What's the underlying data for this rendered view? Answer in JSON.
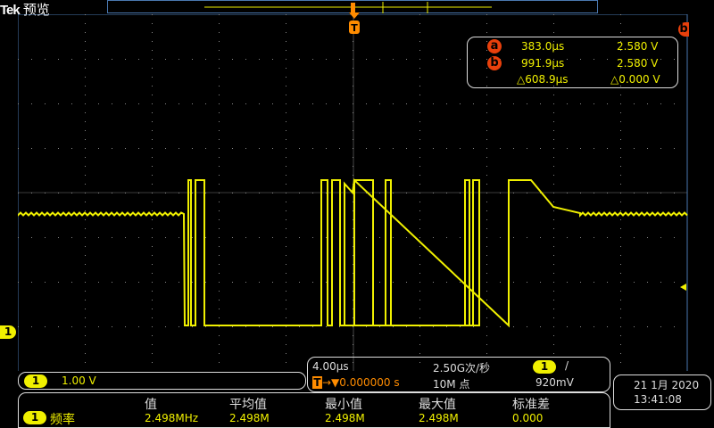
{
  "header": {
    "brand": "Tek",
    "title": "预览"
  },
  "colors": {
    "trace": "#f0f000",
    "cursor": "#e8400c",
    "trigger": "#ff8c00",
    "grid": "#4a78b0"
  },
  "cursors": {
    "a": {
      "label": "a",
      "time": "383.0µs",
      "volt": "2.580 V"
    },
    "b": {
      "label": "b",
      "time": "991.9µs",
      "volt": "2.580 V"
    },
    "delta": {
      "time": "△608.9µs",
      "volt": "△0.000 V"
    }
  },
  "channel": {
    "number": "1",
    "scale": "1.00 V"
  },
  "horizontal": {
    "scale": "4.00µs",
    "sample_rate": "2.50G次/秒",
    "trigger_position": "0.000000 s",
    "record_length": "10M 点",
    "trigger_channel": "1",
    "trigger_slope": "/",
    "trigger_level": "920mV",
    "trigger_icon": "T"
  },
  "measurements": {
    "headers": [
      "值",
      "平均值",
      "最小值",
      "最大值",
      "标准差"
    ],
    "row": {
      "channel": "1",
      "name": "频率",
      "values": [
        "2.498MHz",
        "2.498M",
        "2.498M",
        "2.498M",
        "0.000"
      ]
    }
  },
  "datetime": {
    "date": "21 1月 2020",
    "time": "13:41:08"
  }
}
